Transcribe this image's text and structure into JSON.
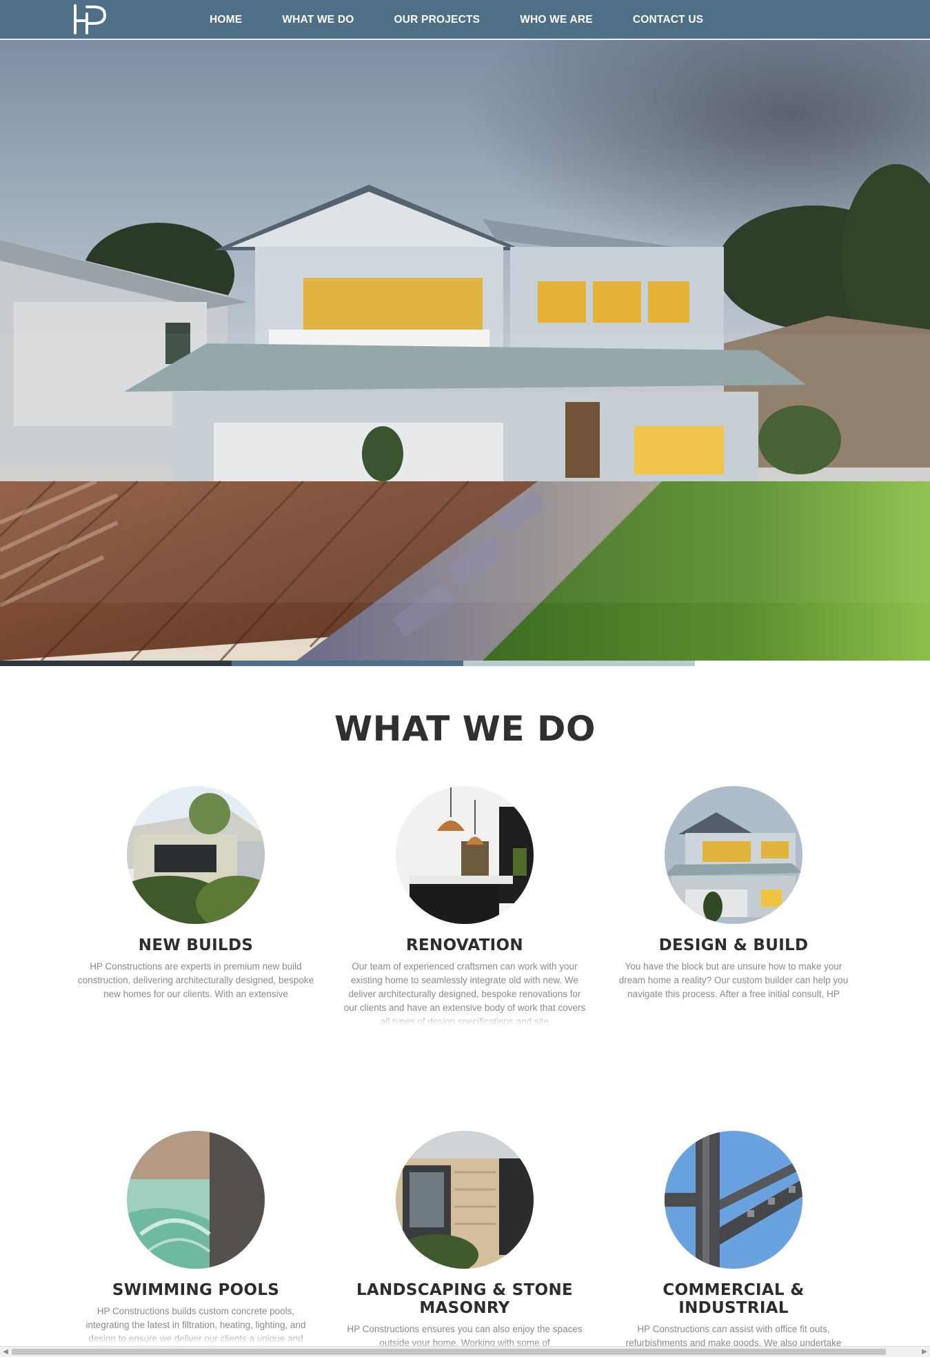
{
  "nav": {
    "logo_text": "HP",
    "items": [
      {
        "label": "HOME"
      },
      {
        "label": "WHAT WE DO"
      },
      {
        "label": "OUR PROJECTS"
      },
      {
        "label": "WHO WE ARE"
      },
      {
        "label": "CONTACT US"
      }
    ]
  },
  "hero": {
    "slides": [
      {
        "color": "#2f3740"
      },
      {
        "color": "#4e6f86"
      },
      {
        "color": "#b9c9d3"
      }
    ]
  },
  "section": {
    "title": "WHAT WE DO"
  },
  "services": [
    {
      "title": "NEW BUILDS",
      "text": "HP Constructions are experts in premium new build construction, delivering architecturally designed, bespoke new homes for our clients. With an extensive"
    },
    {
      "title": "RENOVATION",
      "text": "Our team of experienced craftsmen can work with your existing home to seamlessly integrate old with new. We deliver architecturally designed, bespoke renovations for our clients and have an extensive body of work that covers all types of design specifications and site"
    },
    {
      "title": "DESIGN & BUILD",
      "text": "You have the block but are unsure how to make your dream home a reality? Our custom builder can help you navigate this process. After a free initial consult, HP"
    },
    {
      "title": "SWIMMING POOLS",
      "text": "HP Constructions builds custom concrete pools, integrating the latest in filtration, heating, lighting, and design to ensure we deliver our clients a unique and"
    },
    {
      "title": "LANDSCAPING & STONE MASONRY",
      "text": "HP Constructions ensures you can also enjoy the spaces outside your home. Working with some of"
    },
    {
      "title": "COMMERCIAL & INDUSTRIAL",
      "text": "HP Constructions can assist with office fit outs, refurbishments and make goods. We also undertake projects in warehouse refurbishment and extensions."
    }
  ],
  "colors": {
    "nav_bg": "#4e6f86",
    "title_text": "#303030",
    "body_text": "#8a8a8a"
  }
}
